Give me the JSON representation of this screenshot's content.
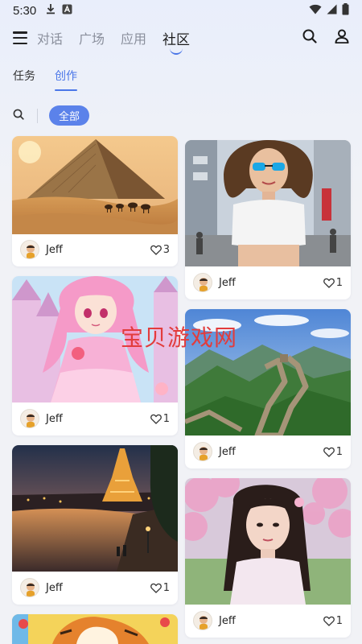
{
  "status_bar": {
    "time": "5:30"
  },
  "nav": {
    "tabs": [
      {
        "label": "对话"
      },
      {
        "label": "广场"
      },
      {
        "label": "应用"
      },
      {
        "label": "社区"
      }
    ],
    "active_tab": "社区"
  },
  "sub_tabs": [
    {
      "label": "任务"
    },
    {
      "label": "创作"
    }
  ],
  "active_sub_tab": "创作",
  "filter": {
    "chip_label": "全部"
  },
  "cards": [
    {
      "author": "Jeff",
      "likes": "3",
      "subject": "pyramid in desert with camels"
    },
    {
      "author": "Jeff",
      "likes": "1",
      "subject": "woman with blue sunglasses in city street"
    },
    {
      "author": "Jeff",
      "likes": "1",
      "subject": "anime girl in pink dress before castle"
    },
    {
      "author": "Jeff",
      "likes": "1",
      "subject": "great wall in green mountains"
    },
    {
      "author": "Jeff",
      "likes": "1",
      "subject": "eiffel tower at night by river"
    },
    {
      "author": "Jeff",
      "likes": "1",
      "subject": "woman under cherry blossoms"
    },
    {
      "author": "",
      "likes": "",
      "subject": "cartoon tiger"
    }
  ],
  "watermark": "宝贝游戏网",
  "colors": {
    "accent": "#4a76e8",
    "chip": "#5b82ea",
    "watermark": "#e23c3c"
  }
}
